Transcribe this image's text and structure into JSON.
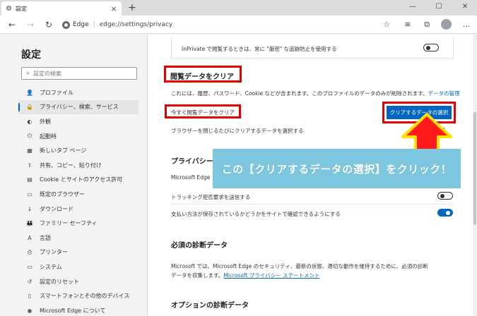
{
  "tab": {
    "title": "設定",
    "close": "×",
    "new": "+"
  },
  "window": {
    "minimize": "—",
    "maximize": "☐",
    "close": "✕"
  },
  "toolbar": {
    "brand": "Edge",
    "separator": "|",
    "url": "edge://settings/privacy"
  },
  "sidebar": {
    "title": "設定",
    "search_placeholder": "設定の検索",
    "items": [
      {
        "label": "プロファイル",
        "icon": "person-icon",
        "glyph": "👤"
      },
      {
        "label": "プライバシー、検索、サービス",
        "icon": "lock-icon",
        "glyph": "🔒",
        "active": true
      },
      {
        "label": "外観",
        "icon": "palette-icon",
        "glyph": "◐"
      },
      {
        "label": "起動時",
        "icon": "power-icon",
        "glyph": "⏻"
      },
      {
        "label": "新しいタブ ページ",
        "icon": "newtab-icon",
        "glyph": "▦"
      },
      {
        "label": "共有、コピー、貼り付け",
        "icon": "share-icon",
        "glyph": "⇪"
      },
      {
        "label": "Cookie とサイトのアクセス許可",
        "icon": "site-permissions-icon",
        "glyph": "▤"
      },
      {
        "label": "既定のブラウザー",
        "icon": "browser-icon",
        "glyph": "▭"
      },
      {
        "label": "ダウンロード",
        "icon": "download-icon",
        "glyph": "↓"
      },
      {
        "label": "ファミリー セーフティ",
        "icon": "family-icon",
        "glyph": "👪"
      },
      {
        "label": "言語",
        "icon": "language-icon",
        "glyph": "A"
      },
      {
        "label": "プリンター",
        "icon": "printer-icon",
        "glyph": "⎙"
      },
      {
        "label": "システム",
        "icon": "system-icon",
        "glyph": "▭"
      },
      {
        "label": "設定のリセット",
        "icon": "reset-icon",
        "glyph": "↺"
      },
      {
        "label": "スマートフォンとその他のデバイス",
        "icon": "phone-icon",
        "glyph": "▯"
      },
      {
        "label": "Microsoft Edge について",
        "icon": "edge-icon",
        "glyph": "◉"
      }
    ]
  },
  "content": {
    "inprivate_text": "InPrivate で閲覧するときは、常に \"厳密\" な追跡防止を使用する",
    "clear_heading": "閲覧データをクリア",
    "clear_desc": "これには、履歴、パスワード、Cookie などが含まれます。このプロファイルのデータのみが削除されます。",
    "manage_link": "データの管理",
    "clear_now_label": "今すぐ閲覧データをクリア",
    "choose_button": "クリアするデータの選択",
    "on_close_label": "ブラウザーを閉じるたびにクリアするデータを選択する",
    "privacy_heading": "プライバシー",
    "privacy_desc_start": "Microsoft Edge",
    "dnt_label": "トラッキング拒否要求を送信する",
    "payment_label": "支払い方法が保存されているかどうかをサイトで確認できるようにする",
    "diag_heading": "必須の診断データ",
    "diag_desc_1": "Microsoft では、Microsoft Edge のセキュリティ、最新の状態、適切な動作を維持するために、必須の診断",
    "diag_desc_2": "データを収集します。",
    "diag_link": "Microsoft プライバシー ステートメント",
    "optional_heading": "オプションの診断データ"
  },
  "toggles": {
    "inprivate": false,
    "dnt": false,
    "payment": true
  },
  "annotation": {
    "callout": "この【クリアするデータの選択】をクリック！",
    "box_color": "#e00000",
    "arrow_color": "#ff1a1a",
    "arrow_outline": "#ffe000",
    "callout_color": "#7dc6e0"
  },
  "colors": {
    "accent": "#0067c0"
  }
}
